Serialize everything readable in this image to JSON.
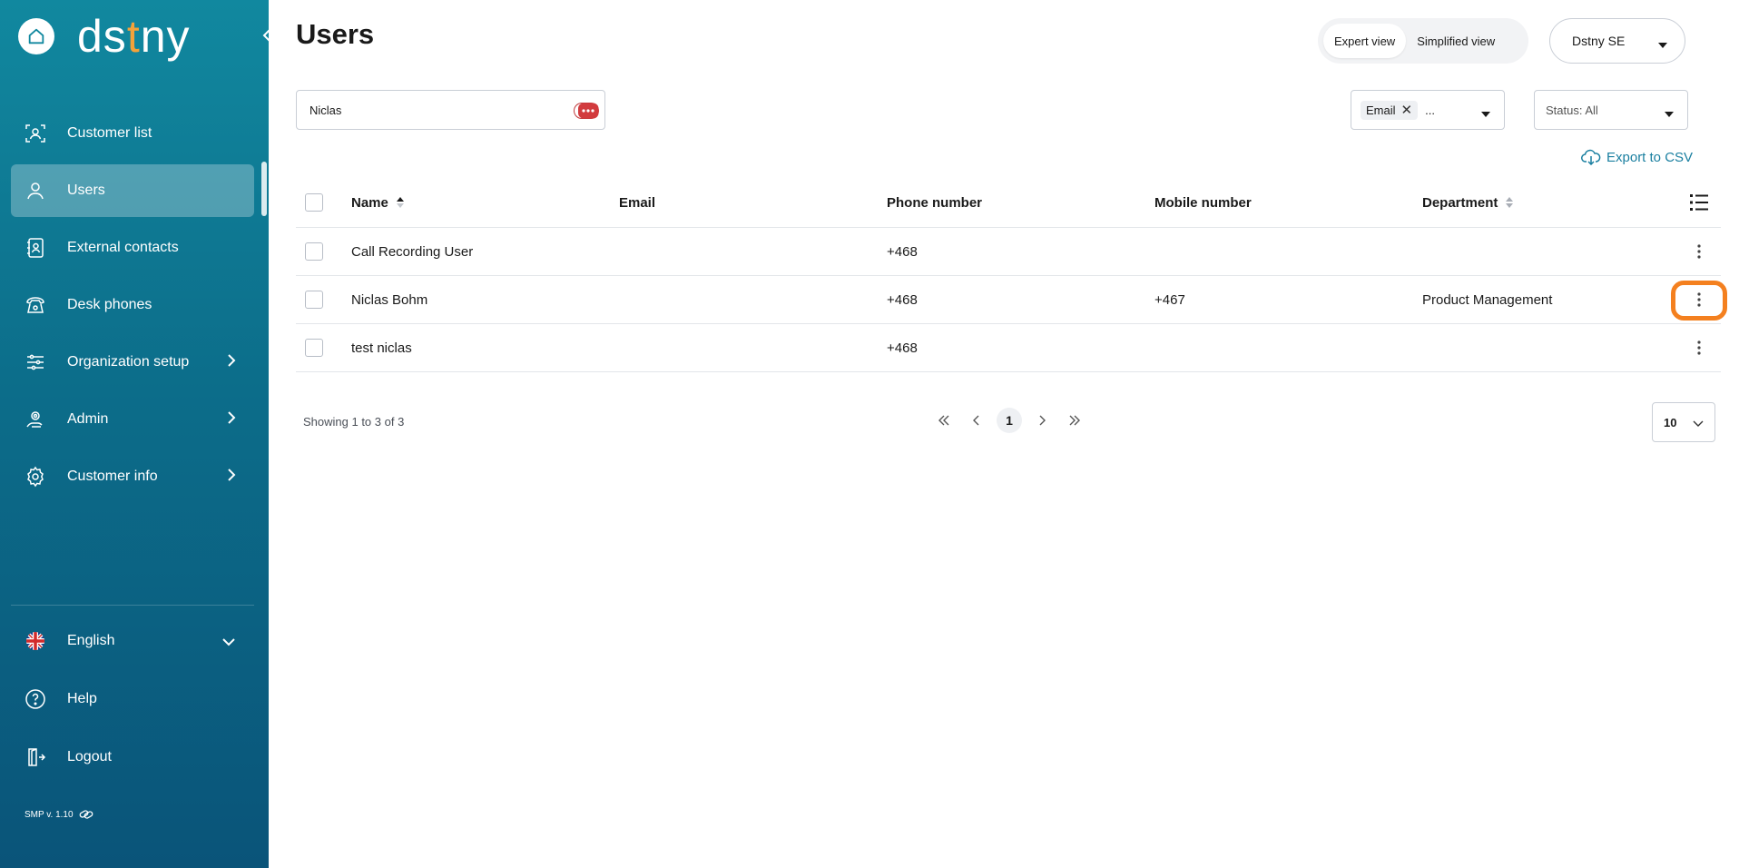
{
  "sidebar": {
    "logo": {
      "pre": "ds",
      "dot": "t",
      "post": "ny"
    },
    "items": [
      {
        "label": "Customer list",
        "icon": "customer-list-icon"
      },
      {
        "label": "Users",
        "icon": "user-icon",
        "active": true
      },
      {
        "label": "External contacts",
        "icon": "contacts-book-icon"
      },
      {
        "label": "Desk phones",
        "icon": "desk-phone-icon"
      },
      {
        "label": "Organization setup",
        "icon": "sliders-icon"
      },
      {
        "label": "Admin",
        "icon": "admin-icon"
      },
      {
        "label": "Customer info",
        "icon": "gear-icon"
      }
    ],
    "language": "English",
    "help": "Help",
    "logout": "Logout",
    "version": "SMP v. 1.10"
  },
  "header": {
    "title": "Users",
    "view_expert": "Expert view",
    "view_simplified": "Simplified view",
    "org": "Dstny SE"
  },
  "filters": {
    "search_value": "Niclas",
    "email_chip": "Email",
    "email_more": "...",
    "status": "Status: All"
  },
  "export_label": "Export to CSV",
  "table": {
    "columns": {
      "name": "Name",
      "email": "Email",
      "phone": "Phone number",
      "mobile": "Mobile number",
      "department": "Department"
    },
    "rows": [
      {
        "name": "Call Recording User",
        "email": "",
        "phone": "+468",
        "mobile": "",
        "department": ""
      },
      {
        "name": "Niclas Bohm",
        "email": "",
        "phone": "+468",
        "mobile": "+467",
        "department": "Product Management"
      },
      {
        "name": "test niclas",
        "email": "",
        "phone": "+468",
        "mobile": "",
        "department": ""
      }
    ]
  },
  "pagination": {
    "showing": "Showing 1 to 3 of 3",
    "current_page": "1",
    "page_size": "10"
  },
  "colors": {
    "accent": "#1a7fa0",
    "sidebar_top": "#11889f",
    "sidebar_bottom": "#0a5479",
    "highlight": "#f4801f"
  }
}
